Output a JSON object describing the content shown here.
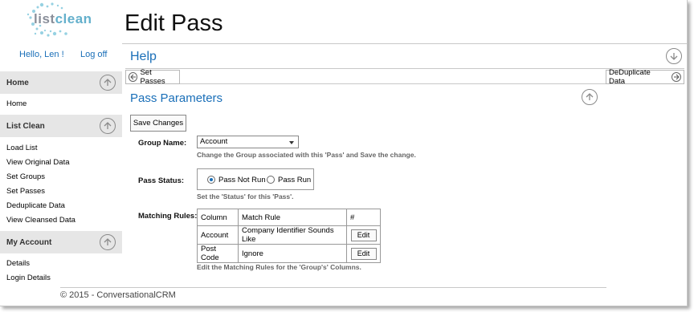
{
  "brand": {
    "logo_part1": "list",
    "logo_part2": "clean"
  },
  "user": {
    "greeting": "Hello, Len !",
    "logoff": "Log off"
  },
  "sidebar": {
    "sections": [
      {
        "title": "Home",
        "items": [
          "Home"
        ]
      },
      {
        "title": "List Clean",
        "items": [
          "Load List",
          "View Original Data",
          "Set Groups",
          "Set Passes",
          "Deduplicate Data",
          "View Cleansed Data"
        ]
      },
      {
        "title": "My Account",
        "items": [
          "Details",
          "Login Details"
        ]
      }
    ]
  },
  "page": {
    "title": "Edit Pass",
    "help": "Help"
  },
  "nav": {
    "prev": "Set Passes",
    "next": "DeDuplicate Data"
  },
  "form": {
    "section_title": "Pass Parameters",
    "save_label": "Save Changes",
    "group_label": "Group Name:",
    "group_value": "Account",
    "group_hint": "Change the Group associated with this 'Pass' and Save the change.",
    "status_label": "Pass Status:",
    "status_options": [
      "Pass Not Run",
      "Pass Run"
    ],
    "status_selected": "Pass Not Run",
    "status_hint": "Set the 'Status' for this 'Pass'.",
    "rules_label": "Matching Rules:",
    "rules_headers": [
      "Column",
      "Match Rule",
      "#"
    ],
    "rules_rows": [
      {
        "column": "Account",
        "rule": "Company Identifier Sounds Like",
        "action": "Edit"
      },
      {
        "column": "Post Code",
        "rule": "Ignore",
        "action": "Edit"
      }
    ],
    "rules_hint": "Edit the Matching Rules for the 'Group's' Columns."
  },
  "footer": {
    "text": "© 2015 - ConversationalCRM"
  },
  "colors": {
    "link": "#1a6fb8",
    "section_bg": "#e6e6e6",
    "logo_accent": "#64b0cc"
  },
  "icons": [
    "arrow-up-circle-icon",
    "arrow-down-circle-icon",
    "arrow-left-circle-icon",
    "arrow-right-circle-icon"
  ]
}
